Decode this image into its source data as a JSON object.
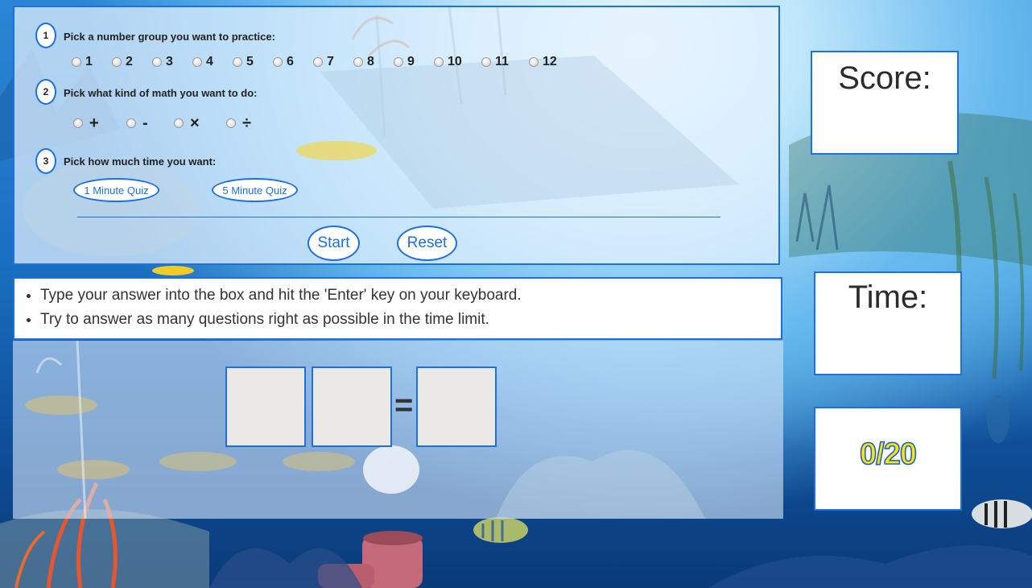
{
  "setup": {
    "step1": {
      "number": "1",
      "label": "Pick a number group you want to practice:"
    },
    "number_groups": [
      "1",
      "2",
      "3",
      "4",
      "5",
      "6",
      "7",
      "8",
      "9",
      "10",
      "11",
      "12"
    ],
    "step2": {
      "number": "2",
      "label": "Pick what kind of math you want to do:"
    },
    "operations": [
      "+",
      "-",
      "×",
      "÷"
    ],
    "step3": {
      "number": "3",
      "label": "Pick how much time you want:"
    },
    "quiz_1min": "1 Minute Quiz",
    "quiz_5min": "5 Minute Quiz",
    "start": "Start",
    "reset": "Reset"
  },
  "instructions": [
    "Type your answer into the box and hit the 'Enter' key on your keyboard.",
    "Try to answer as many questions right as possible in the time limit."
  ],
  "quiz": {
    "equals": "="
  },
  "score": {
    "title": "Score:"
  },
  "time": {
    "title": "Time:"
  },
  "progress": {
    "text": "0/20"
  },
  "colors": {
    "accent": "#1e6fe0",
    "progress_fill": "#ffe600"
  }
}
